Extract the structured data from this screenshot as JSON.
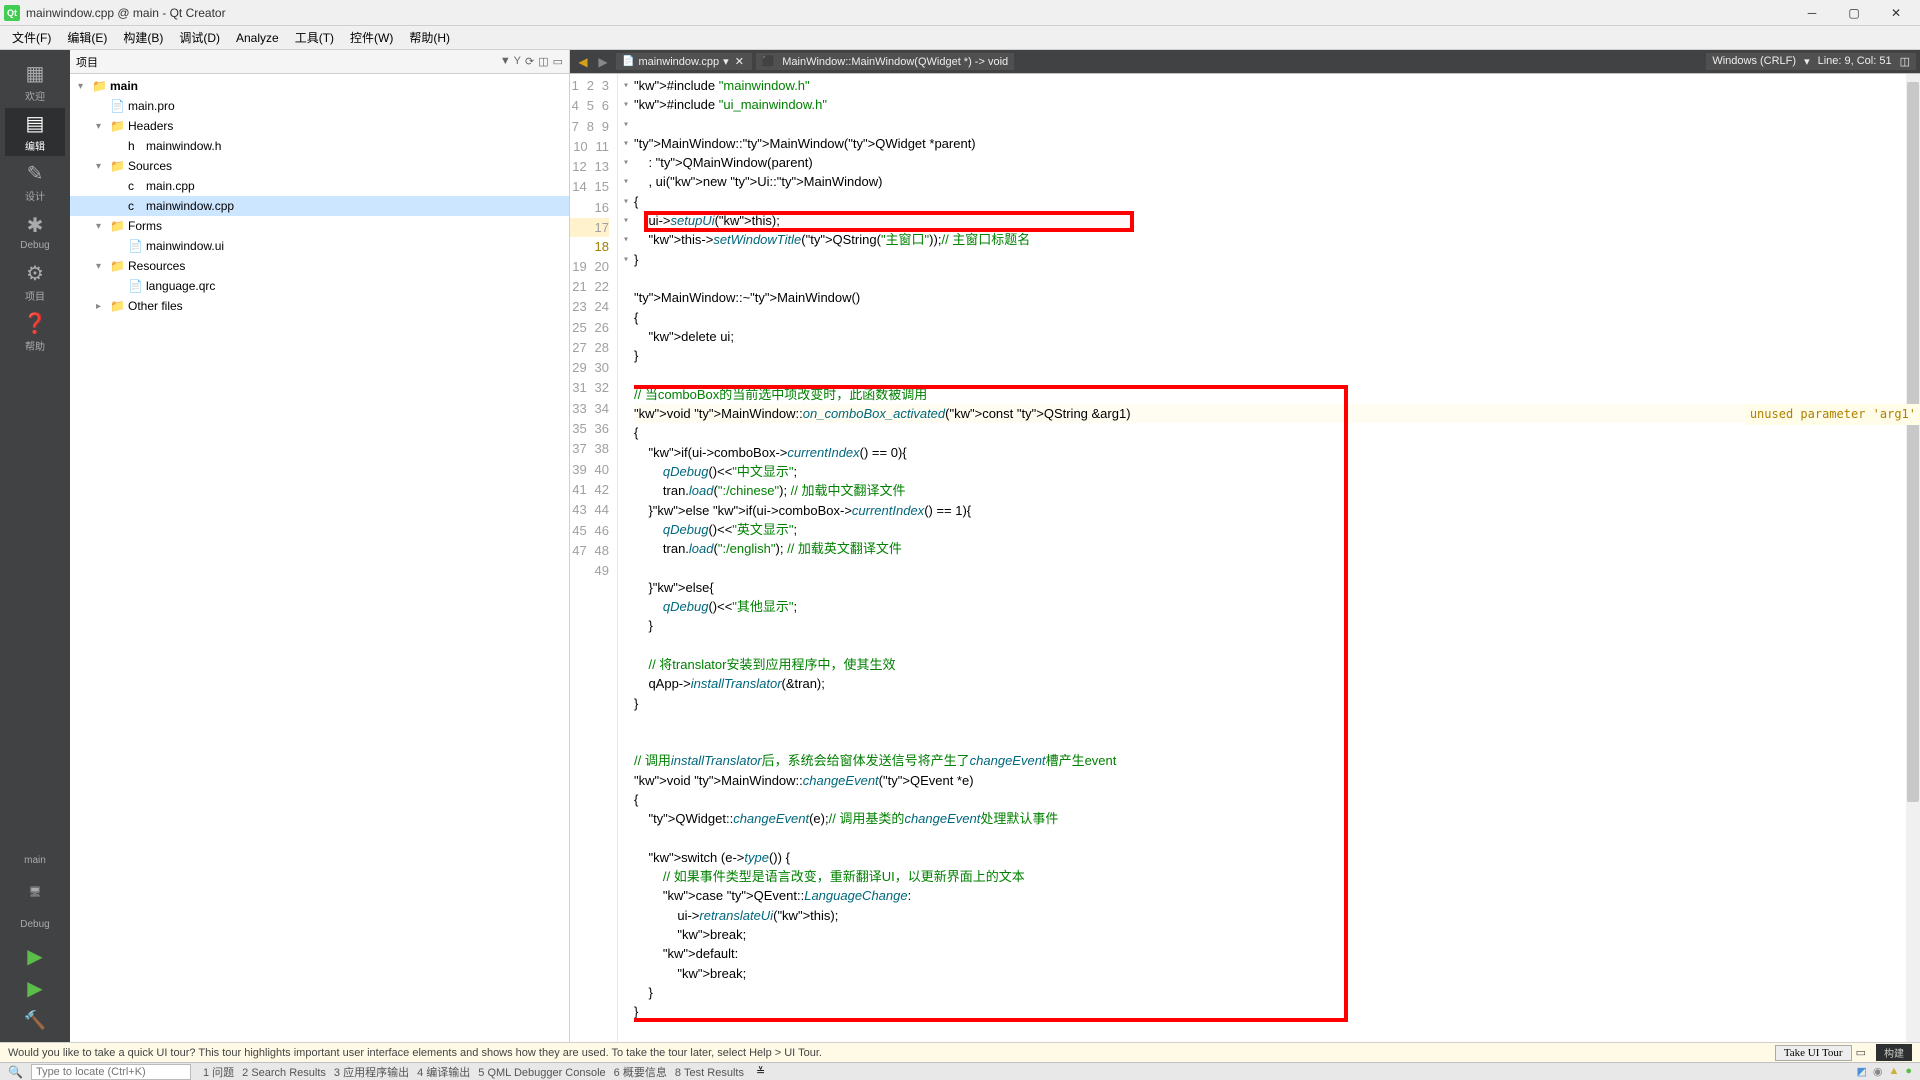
{
  "title": "mainwindow.cpp @ main - Qt Creator",
  "menu": [
    "文件(F)",
    "编辑(E)",
    "构建(B)",
    "调试(D)",
    "Analyze",
    "工具(T)",
    "控件(W)",
    "帮助(H)"
  ],
  "sidebar": [
    {
      "label": "欢迎",
      "active": false
    },
    {
      "label": "编辑",
      "active": true
    },
    {
      "label": "设计",
      "active": false
    },
    {
      "label": "Debug",
      "active": false
    },
    {
      "label": "项目",
      "active": false
    },
    {
      "label": "帮助",
      "active": false
    }
  ],
  "sidebar_bottom": {
    "main": "main",
    "debug": "Debug"
  },
  "panel": {
    "title": "项目"
  },
  "tree": [
    {
      "d": 1,
      "chev": "▾",
      "ico": "📁",
      "txt": "main",
      "bold": true
    },
    {
      "d": 2,
      "chev": "",
      "ico": "📄",
      "txt": "main.pro"
    },
    {
      "d": 2,
      "chev": "▾",
      "ico": "📁",
      "txt": "Headers"
    },
    {
      "d": 3,
      "chev": "",
      "ico": "h",
      "txt": "mainwindow.h"
    },
    {
      "d": 2,
      "chev": "▾",
      "ico": "📁",
      "txt": "Sources"
    },
    {
      "d": 3,
      "chev": "",
      "ico": "c",
      "txt": "main.cpp"
    },
    {
      "d": 3,
      "chev": "",
      "ico": "c",
      "txt": "mainwindow.cpp",
      "sel": true
    },
    {
      "d": 2,
      "chev": "▾",
      "ico": "📁",
      "txt": "Forms"
    },
    {
      "d": 3,
      "chev": "",
      "ico": "📄",
      "txt": "mainwindow.ui"
    },
    {
      "d": 2,
      "chev": "▾",
      "ico": "📁",
      "txt": "Resources"
    },
    {
      "d": 3,
      "chev": "",
      "ico": "📄",
      "txt": "language.qrc"
    },
    {
      "d": 2,
      "chev": "▸",
      "ico": "📁",
      "txt": "Other files"
    }
  ],
  "tab": {
    "file": "mainwindow.cpp",
    "breadcrumb": "MainWindow::MainWindow(QWidget *) -> void"
  },
  "status": {
    "encoding": "Windows (CRLF)",
    "pos": "Line: 9, Col: 51"
  },
  "warning": "unused parameter 'arg1'",
  "tour_msg": "Would you like to take a quick UI tour? This tour highlights important user interface elements and shows how they are used. To take the tour later, select Help > UI Tour.",
  "tour_btn": "Take UI Tour",
  "build_badge": "构建",
  "locator_placeholder": "Type to locate (Ctrl+K)",
  "out_tabs": [
    "1 问题",
    "2 Search Results",
    "3 应用程序输出",
    "4 编译输出",
    "5 QML Debugger Console",
    "6 概要信息",
    "8 Test Results"
  ],
  "code_lines": [
    "#include \"mainwindow.h\"",
    "#include \"ui_mainwindow.h\"",
    "",
    "MainWindow::MainWindow(QWidget *parent)",
    "    : QMainWindow(parent)",
    "    , ui(new Ui::MainWindow)",
    "{",
    "    ui->setupUi(this);",
    "    this->setWindowTitle(QString(\"主窗口\"));// 主窗口标题名",
    "}",
    "",
    "MainWindow::~MainWindow()",
    "{",
    "    delete ui;",
    "}",
    "",
    "// 当comboBox的当前选中项改变时，此函数被调用",
    "void MainWindow::on_comboBox_activated(const QString &arg1)",
    "{",
    "    if(ui->comboBox->currentIndex() == 0){",
    "        qDebug()<<\"中文显示\";",
    "        tran.load(\":/chinese\"); // 加载中文翻译文件",
    "    }else if(ui->comboBox->currentIndex() == 1){",
    "        qDebug()<<\"英文显示\";",
    "        tran.load(\":/english\"); // 加载英文翻译文件",
    "",
    "    }else{",
    "        qDebug()<<\"其他显示\";",
    "    }",
    "",
    "    // 将translator安装到应用程序中，使其生效",
    "    qApp->installTranslator(&tran);",
    "}",
    "",
    "",
    "// 调用installTranslator后，系统会给窗体发送信号将产生了changeEvent槽产生event",
    "void MainWindow::changeEvent(QEvent *e)",
    "{",
    "    QWidget::changeEvent(e);// 调用基类的changeEvent处理默认事件",
    "",
    "    switch (e->type()) {",
    "        // 如果事件类型是语言改变，重新翻译UI，以更新界面上的文本",
    "        case QEvent::LanguageChange:",
    "            ui->retranslateUi(this);",
    "            break;",
    "        default:",
    "            break;",
    "    }",
    "}"
  ]
}
